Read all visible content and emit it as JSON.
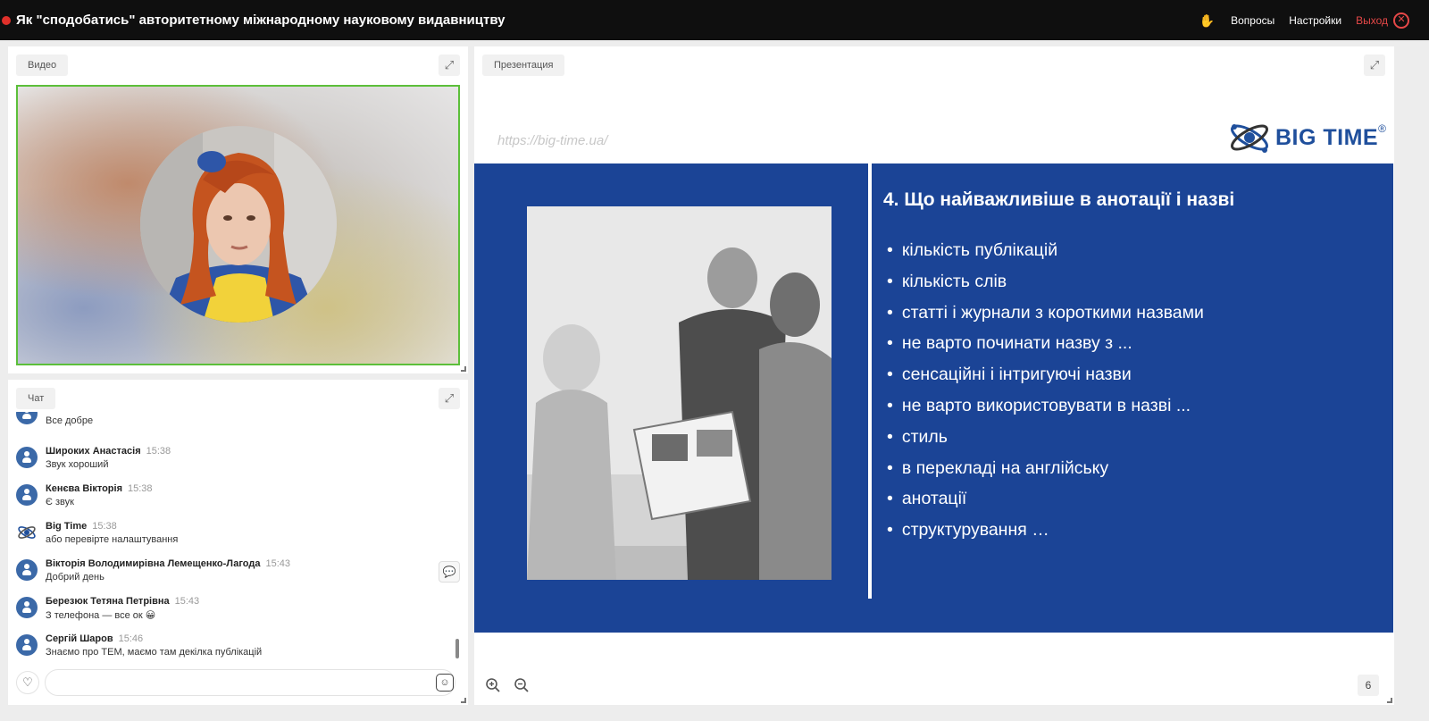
{
  "header": {
    "title": "Як \"сподобатись\" авторитетному міжнародному науковому видавництву",
    "links": [
      "Вопросы",
      "Настройки"
    ],
    "exit_label": "Выход"
  },
  "video_panel": {
    "label": "Видео"
  },
  "chat_panel": {
    "label": "Чат",
    "messages": [
      {
        "name": "",
        "time": "",
        "text": "Все добре"
      },
      {
        "name": "Широких Анастасія",
        "time": "15:38",
        "text": "Звук хороший"
      },
      {
        "name": "Кенєва Вікторія",
        "time": "15:38",
        "text": "Є звук"
      },
      {
        "name": "Big Time",
        "time": "15:38",
        "text": "або перевірте налаштування"
      },
      {
        "name": "Вікторія Володимирівна Лемещенко-Лагода",
        "time": "15:43",
        "text": "Добрий день"
      },
      {
        "name": "Березюк Тетяна Петрівна",
        "time": "15:43",
        "text": "З телефона — все ок 😀"
      },
      {
        "name": "Сергій Шаров",
        "time": "15:46",
        "text": "Знаємо про ТЕМ, маємо там декілка публікацій"
      }
    ],
    "input_value": ""
  },
  "presentation": {
    "label": "Презентация",
    "slide": {
      "url": "https://big-time.ua/",
      "brand": "BIG TIME",
      "brand_mark": "®",
      "heading": "4. Що найважливіше в анотації і назві",
      "bullets": [
        "кількість публікацій",
        "кількість слів",
        "статті і журнали з короткими назвами",
        "не варто починати назву з ...",
        "сенсаційні і інтригуючі назви",
        "не варто використовувати в назві ...",
        "стиль",
        "в перекладі на англійську",
        "анотації",
        "структурування …"
      ]
    },
    "page_number": "6"
  },
  "colors": {
    "slide_blue": "#1b4496",
    "video_border": "#5cbf3a",
    "exit_red": "#e64848",
    "avatar_blue": "#3b69a8"
  }
}
